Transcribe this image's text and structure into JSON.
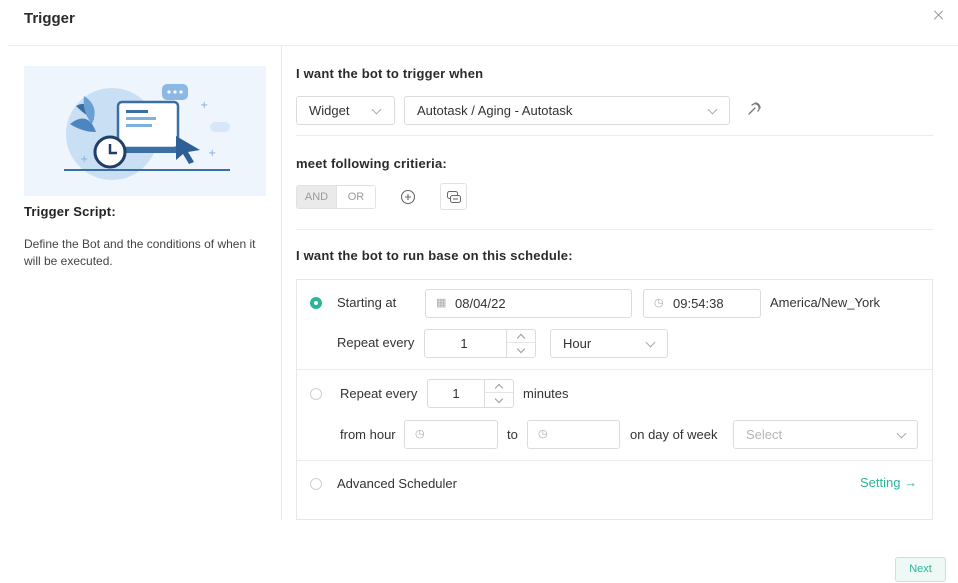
{
  "dialog": {
    "title": "Trigger"
  },
  "left_panel": {
    "title": "Trigger Script:",
    "description": "Define the Bot and the conditions of when it will be executed."
  },
  "trigger": {
    "heading": "I want the bot to trigger when",
    "source_select": "Widget",
    "widget_select": "Autotask / Aging - Autotask"
  },
  "criteria": {
    "heading": "meet following critieria:",
    "and_label": "AND",
    "or_label": "OR"
  },
  "schedule": {
    "heading": "I want the bot to run base on this schedule:",
    "option1": {
      "starting_label": "Starting at",
      "date": "08/04/22",
      "time": "09:54:38",
      "timezone": "America/New_York",
      "repeat_label": "Repeat every",
      "repeat_value": "1",
      "unit": "Hour"
    },
    "option2": {
      "repeat_label": "Repeat every",
      "repeat_value": "1",
      "minutes_label": "minutes",
      "from_hour_label": "from hour",
      "to_label": "to",
      "day_of_week_label": "on day of week",
      "day_placeholder": "Select"
    },
    "option3": {
      "label": "Advanced Scheduler",
      "setting_link": "Setting →"
    }
  },
  "footer": {
    "next_label": "Next"
  },
  "colors": {
    "accent": "#2bb59a",
    "illustration_bg": "#eef5fc"
  }
}
